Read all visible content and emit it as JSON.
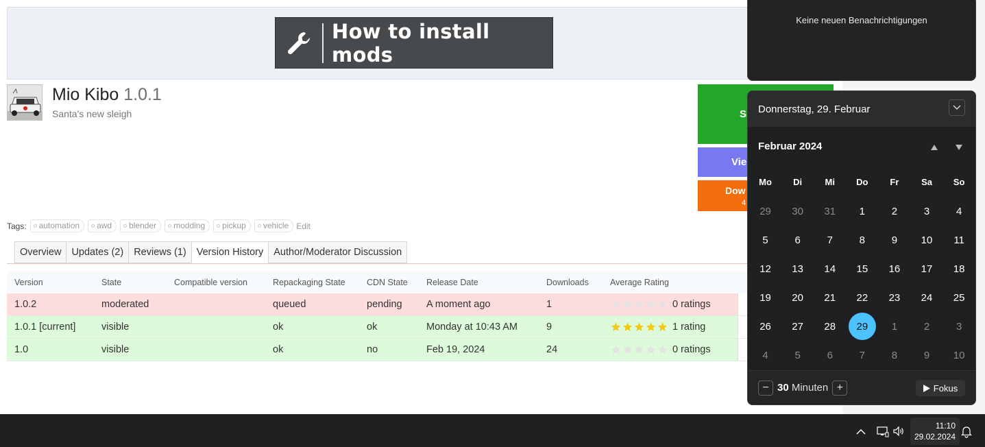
{
  "banner": {
    "text": "How to install mods"
  },
  "mod": {
    "name": "Mio Kibo",
    "version": "1.0.1",
    "subtitle": "Santa's new sleigh"
  },
  "actions": {
    "green_label": "S",
    "purple_label": "Vie",
    "orange_label": "Dow",
    "orange_sub": "4"
  },
  "tags": {
    "label": "Tags:",
    "items": [
      "automation",
      "awd",
      "blender",
      "modding",
      "pickup",
      "vehicle"
    ],
    "edit": "Edit"
  },
  "tabs": [
    {
      "label": "Overview"
    },
    {
      "label": "Updates (2)"
    },
    {
      "label": "Reviews (1)"
    },
    {
      "label": "Version History",
      "active": true
    },
    {
      "label": "Author/Moderator Discussion"
    }
  ],
  "versions": {
    "headers": [
      "Version",
      "State",
      "Compatible version",
      "Repackaging State",
      "CDN State",
      "Release Date",
      "Downloads",
      "Average Rating"
    ],
    "rows": [
      {
        "version": "1.0.2",
        "state": "moderated",
        "compat": "",
        "repack": "queued",
        "cdn": "pending",
        "date": "A moment ago",
        "downloads": "1",
        "stars": 0,
        "rating": "0 ratings",
        "status": "red"
      },
      {
        "version": "1.0.1 [current]",
        "state": "visible",
        "compat": "",
        "repack": "ok",
        "cdn": "ok",
        "date": "Monday at 10:43 AM",
        "downloads": "9",
        "stars": 5,
        "rating": "1 rating",
        "status": "green"
      },
      {
        "version": "1.0",
        "state": "visible",
        "compat": "",
        "repack": "ok",
        "cdn": "no",
        "date": "Feb 19, 2024",
        "downloads": "24",
        "stars": 0,
        "rating": "0 ratings",
        "status": "green"
      }
    ]
  },
  "notifications": {
    "empty_text": "Keine neuen Benachrichtigungen"
  },
  "calendar": {
    "date_header": "Donnerstag, 29. Februar",
    "month_label": "Februar 2024",
    "weekdays": [
      "Mo",
      "Di",
      "Mi",
      "Do",
      "Fr",
      "Sa",
      "So"
    ],
    "weeks": [
      [
        [
          "29",
          1
        ],
        [
          "30",
          1
        ],
        [
          "31",
          1
        ],
        [
          "1",
          0
        ],
        [
          "2",
          0
        ],
        [
          "3",
          0
        ],
        [
          "4",
          0
        ]
      ],
      [
        [
          "5",
          0
        ],
        [
          "6",
          0
        ],
        [
          "7",
          0
        ],
        [
          "8",
          0
        ],
        [
          "9",
          0
        ],
        [
          "10",
          0
        ],
        [
          "11",
          0
        ]
      ],
      [
        [
          "12",
          0
        ],
        [
          "13",
          0
        ],
        [
          "14",
          0
        ],
        [
          "15",
          0
        ],
        [
          "16",
          0
        ],
        [
          "17",
          0
        ],
        [
          "18",
          0
        ]
      ],
      [
        [
          "19",
          0
        ],
        [
          "20",
          0
        ],
        [
          "21",
          0
        ],
        [
          "22",
          0
        ],
        [
          "23",
          0
        ],
        [
          "24",
          0
        ],
        [
          "25",
          0
        ]
      ],
      [
        [
          "26",
          0
        ],
        [
          "27",
          0
        ],
        [
          "28",
          0
        ],
        [
          "29",
          2
        ],
        [
          "1",
          1
        ],
        [
          "2",
          1
        ],
        [
          "3",
          1
        ]
      ],
      [
        [
          "4",
          1
        ],
        [
          "5",
          1
        ],
        [
          "6",
          1
        ],
        [
          "7",
          1
        ],
        [
          "8",
          1
        ],
        [
          "9",
          1
        ],
        [
          "10",
          1
        ]
      ]
    ],
    "focus_minutes": "30",
    "minutes_label": "Minuten",
    "focus_button": "Fokus",
    "accent": "#4cc2ff"
  },
  "taskbar": {
    "time": "11:10",
    "date": "29.02.2024"
  },
  "colors": {
    "green": "#22a729",
    "purple": "#7878f0",
    "orange": "#f36d0c",
    "star": "#f2c811"
  }
}
